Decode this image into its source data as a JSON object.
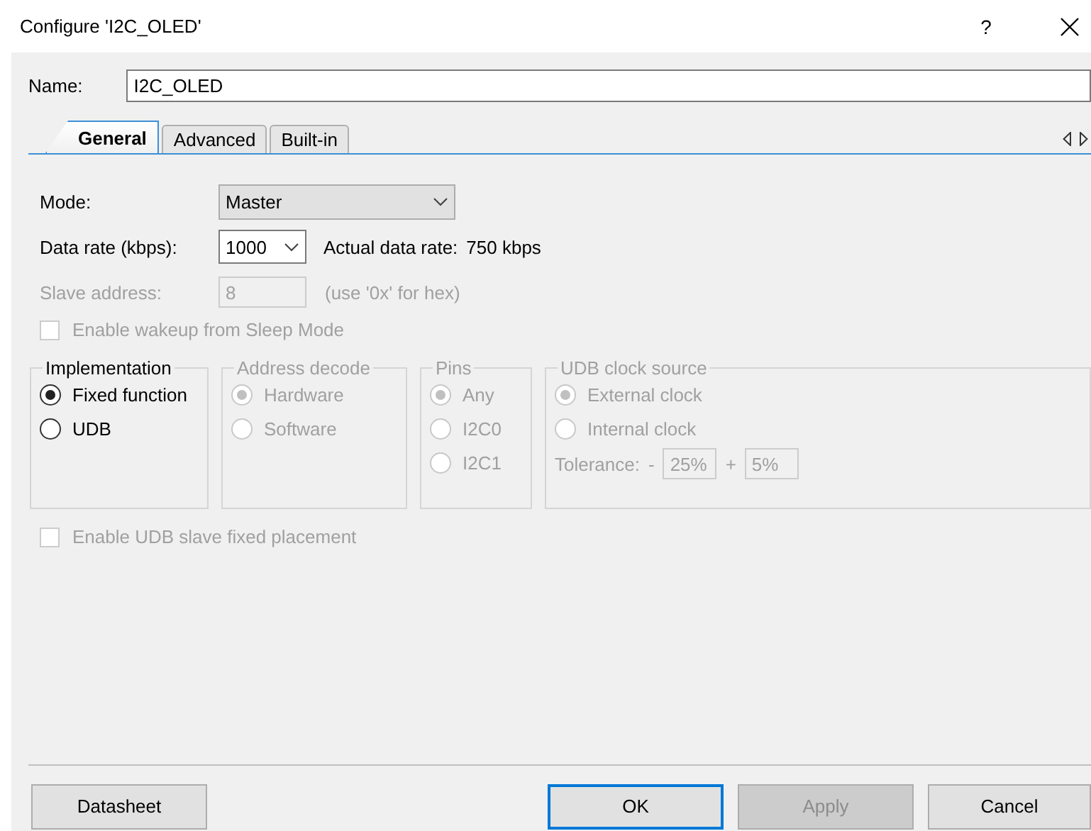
{
  "window": {
    "title": "Configure 'I2C_OLED'",
    "help": "?"
  },
  "name": {
    "label": "Name:",
    "value": "I2C_OLED"
  },
  "tabs": [
    {
      "label": "General",
      "selected": true
    },
    {
      "label": "Advanced",
      "selected": false
    },
    {
      "label": "Built-in",
      "selected": false
    }
  ],
  "mode": {
    "label": "Mode:",
    "value": "Master"
  },
  "data_rate": {
    "label": "Data rate (kbps):",
    "value": "1000",
    "actual_label": "Actual data rate:",
    "actual_value": "750 kbps"
  },
  "slave_address": {
    "label": "Slave address:",
    "value": "8",
    "hint": "(use '0x' for hex)",
    "disabled": true
  },
  "wakeup": {
    "label": "Enable wakeup from Sleep Mode",
    "checked": false,
    "disabled": true
  },
  "groups": [
    {
      "title": "Implementation",
      "disabled": false,
      "options": [
        {
          "label": "Fixed function",
          "selected": true
        },
        {
          "label": "UDB",
          "selected": false
        }
      ]
    },
    {
      "title": "Address decode",
      "disabled": true,
      "options": [
        {
          "label": "Hardware",
          "selected": true
        },
        {
          "label": "Software",
          "selected": false
        }
      ]
    },
    {
      "title": "Pins",
      "disabled": true,
      "options": [
        {
          "label": "Any",
          "selected": true
        },
        {
          "label": "I2C0",
          "selected": false
        },
        {
          "label": "I2C1",
          "selected": false
        }
      ]
    },
    {
      "title": "UDB clock source",
      "disabled": true,
      "options": [
        {
          "label": "External clock",
          "selected": true
        },
        {
          "label": "Internal clock",
          "selected": false
        }
      ],
      "tolerance": {
        "label": "Tolerance:",
        "minus": "-",
        "low": "25%",
        "plus": "+",
        "high": "5%"
      }
    }
  ],
  "udb_placement": {
    "label": "Enable UDB slave fixed placement",
    "checked": false,
    "disabled": true
  },
  "footer": {
    "left": [
      {
        "label": "Datasheet",
        "default": false,
        "disabled": false
      }
    ],
    "right": [
      {
        "label": "OK",
        "default": true,
        "disabled": false
      },
      {
        "label": "Apply",
        "default": false,
        "disabled": true
      },
      {
        "label": "Cancel",
        "default": false,
        "disabled": false
      }
    ]
  }
}
